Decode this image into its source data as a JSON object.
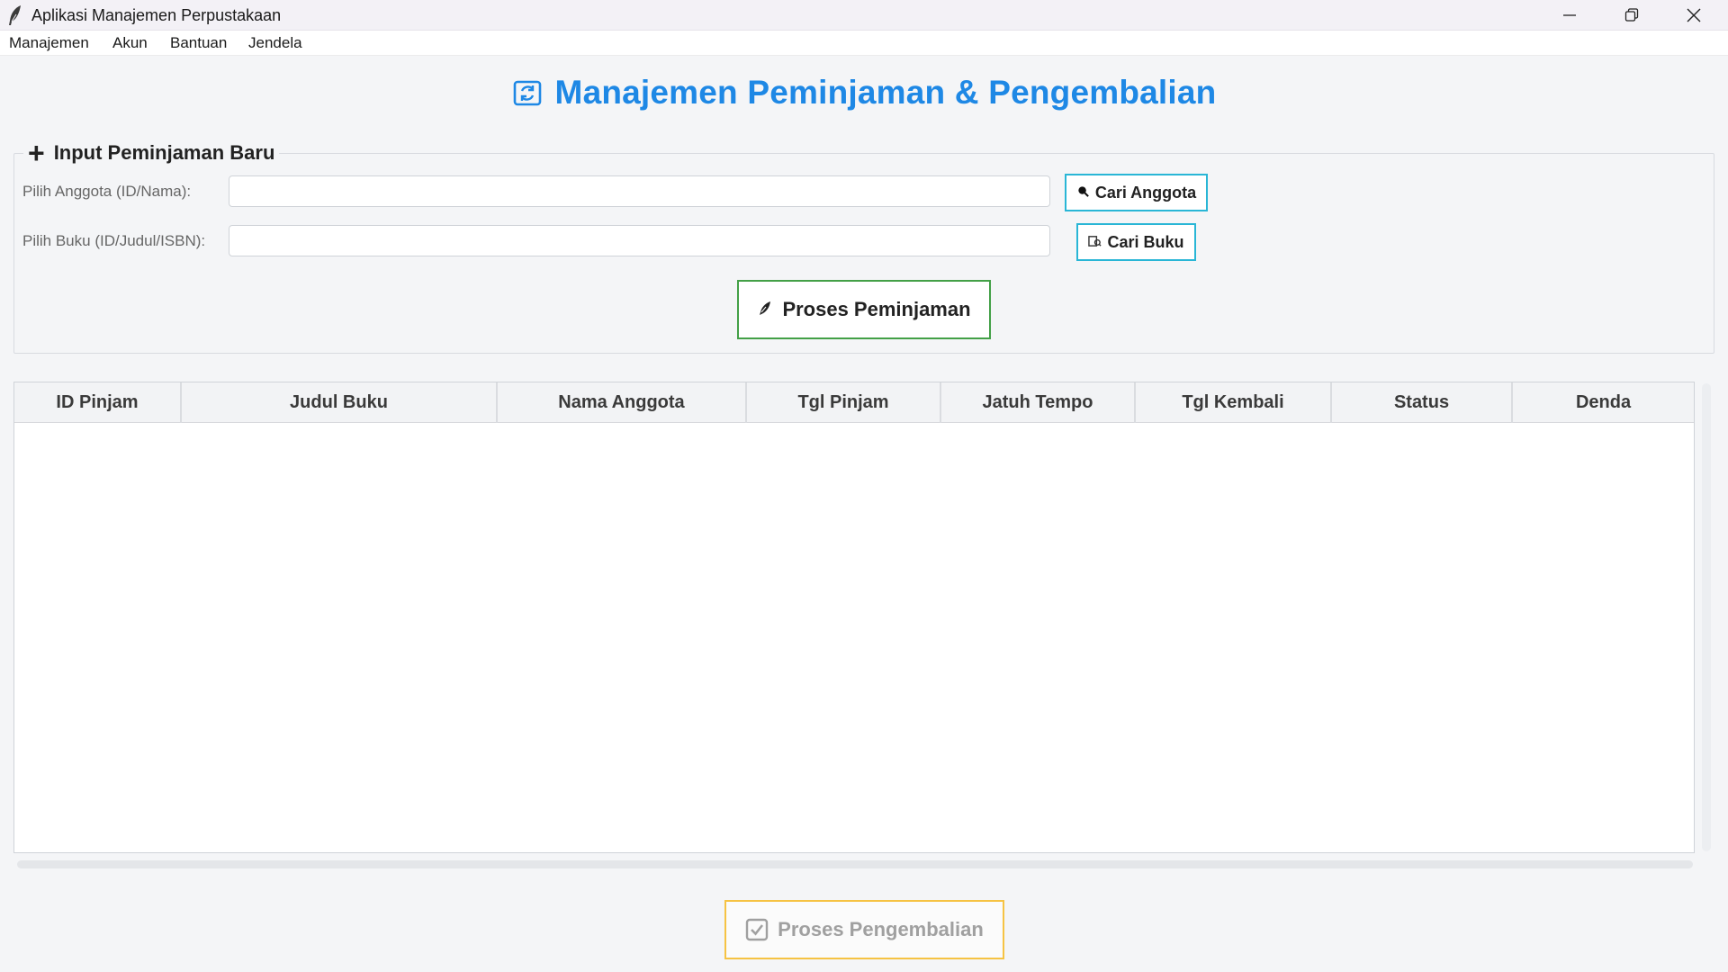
{
  "window": {
    "title": "Aplikasi Manajemen Perpustakaan",
    "app_icon": "feather-icon",
    "controls": [
      "minimize-icon",
      "restore-icon",
      "close-icon"
    ]
  },
  "menubar": {
    "items": [
      "Manajemen",
      "Akun",
      "Bantuan",
      "Jendela"
    ]
  },
  "page": {
    "title": "Manajemen Peminjaman & Pengembalian",
    "title_icon": "refresh-icon",
    "accent_color": "#1e88e5"
  },
  "input_group": {
    "legend": "Input Peminjaman Baru",
    "legend_icon": "plus-icon",
    "member_label": "Pilih Anggota (ID/Nama):",
    "member_value": "",
    "book_label": "Pilih Buku (ID/Judul/ISBN):",
    "book_value": "",
    "search_member_button": "Cari Anggota",
    "search_member_icon": "magnifier-icon",
    "search_book_button": "Cari Buku",
    "search_book_icon": "book-search-icon",
    "process_button": "Proses Peminjaman",
    "process_icon": "quill-icon",
    "search_button_border": "#29b6d6",
    "process_button_border": "#43a047"
  },
  "table": {
    "columns": [
      "ID Pinjam",
      "Judul Buku",
      "Nama Anggota",
      "Tgl Pinjam",
      "Jatuh Tempo",
      "Tgl Kembali",
      "Status",
      "Denda"
    ],
    "rows": []
  },
  "footer": {
    "return_button": "Proses Pengembalian",
    "return_icon": "checkbox-icon",
    "return_button_border": "#f6c343",
    "return_button_state": "disabled"
  }
}
